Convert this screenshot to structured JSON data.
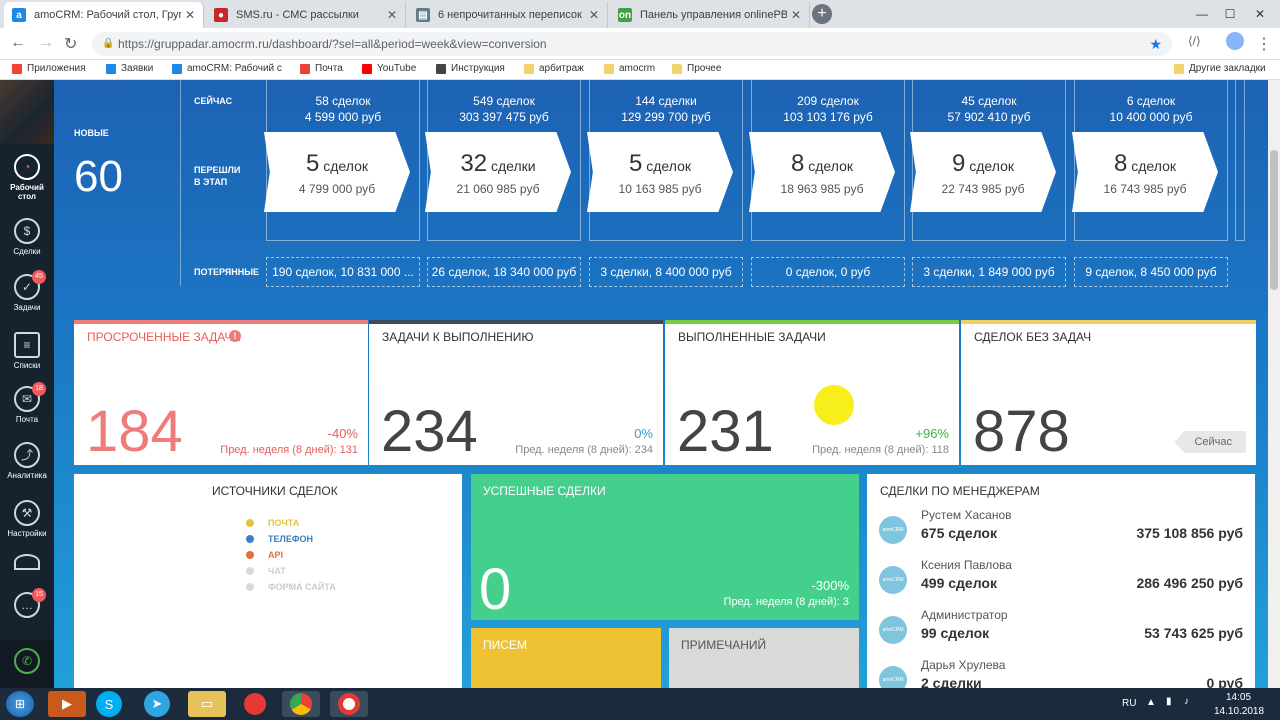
{
  "browser": {
    "tabs": [
      {
        "title": "amoCRM: Рабочий стол, Группа",
        "fav": "a",
        "color": "#1e88e5"
      },
      {
        "title": "SMS.ru - СМС рассылки",
        "fav": "🍒",
        "color": "#c62828"
      },
      {
        "title": "6 непрочитанных переписок",
        "fav": "▤",
        "color": "#607d8b"
      },
      {
        "title": "Панель управления onlinePBX",
        "fav": "on",
        "color": "#43a047"
      }
    ],
    "url": "https://gruppadar.amocrm.ru/dashboard/?sel=all&period=week&view=conversion",
    "bookmarks": [
      "Приложения",
      "Заявки",
      "amoCRM: Рабочий с",
      "Почта",
      "YouTube",
      "Инструкция",
      "арбитраж",
      "amocrm",
      "Прочее",
      "Другие закладки"
    ]
  },
  "sidebar": {
    "items": [
      {
        "label": "Рабочий стол",
        "icon": "dashboard-icon",
        "badge": ""
      },
      {
        "label": "Сделки",
        "icon": "dollar-icon",
        "badge": ""
      },
      {
        "label": "Задачи",
        "icon": "check-icon",
        "badge": "45"
      },
      {
        "label": "Списки",
        "icon": "list-icon",
        "badge": ""
      },
      {
        "label": "Почта",
        "icon": "mail-icon",
        "badge": "18"
      },
      {
        "label": "Аналитика",
        "icon": "chart-icon",
        "badge": ""
      },
      {
        "label": "Настройки",
        "icon": "wrench-icon",
        "badge": ""
      },
      {
        "label": "",
        "icon": "chat-icon",
        "badge": "15"
      }
    ]
  },
  "funnel": {
    "now_label": "СЕЙЧАС",
    "moved_label": "ПЕРЕШЛИ В ЭТАП",
    "lost_label": "ПОТЕРЯННЫЕ",
    "new_label": "НОВЫЕ",
    "new_count": "60",
    "stages": [
      {
        "now_deals": "58 сделок",
        "now_sum": "4 599 000 руб",
        "moved_num": "5",
        "moved_unit": "сделок",
        "moved_sum": "4 799 000 руб",
        "lost": "190 сделок, 10 831 000 ..."
      },
      {
        "now_deals": "549 сделок",
        "now_sum": "303 397 475 руб",
        "moved_num": "32",
        "moved_unit": "сделки",
        "moved_sum": "21 060 985 руб",
        "lost": "26 сделок, 18 340 000 руб"
      },
      {
        "now_deals": "144 сделки",
        "now_sum": "129 299 700 руб",
        "moved_num": "5",
        "moved_unit": "сделок",
        "moved_sum": "10 163 985 руб",
        "lost": "3 сделки, 8 400 000 руб"
      },
      {
        "now_deals": "209 сделок",
        "now_sum": "103 103 176 руб",
        "moved_num": "8",
        "moved_unit": "сделок",
        "moved_sum": "18 963 985 руб",
        "lost": "0 сделок, 0 руб"
      },
      {
        "now_deals": "45 сделок",
        "now_sum": "57 902 410 руб",
        "moved_num": "9",
        "moved_unit": "сделок",
        "moved_sum": "22 743 985 руб",
        "lost": "3 сделки, 1 849 000 руб"
      },
      {
        "now_deals": "6 сделок",
        "now_sum": "10 400 000 руб",
        "moved_num": "8",
        "moved_unit": "сделок",
        "moved_sum": "16 743 985 руб",
        "lost": "9 сделок, 8 450 000 руб"
      }
    ]
  },
  "cards": [
    {
      "title": "ПРОСРОЧЕННЫЕ ЗАДАЧИ",
      "value": "184",
      "pct": "-40%",
      "prev": "Пред. неделя (8 дней): 131",
      "bar": "#f07b7b",
      "valcolor": "#f07b7b",
      "pctcolor": "#e85c5c",
      "prevcolor": "#e85c5c"
    },
    {
      "title": "ЗАДАЧИ К ВЫПОЛНЕНИЮ",
      "value": "234",
      "pct": "0%",
      "prev": "Пред. неделя (8 дней): 234",
      "bar": "#3d4b5a",
      "valcolor": "#444",
      "pctcolor": "#29a3d8",
      "prevcolor": "#888"
    },
    {
      "title": "ВЫПОЛНЕННЫЕ ЗАДАЧИ",
      "value": "231",
      "pct": "+96%",
      "prev": "Пред. неделя (8 дней): 118",
      "bar": "#7ac943",
      "valcolor": "#444",
      "pctcolor": "#3fae49",
      "prevcolor": "#888"
    },
    {
      "title": "СДЕЛОК БЕЗ ЗАДАЧ",
      "value": "878",
      "pct": "",
      "prev": "",
      "bar": "#f0d060",
      "valcolor": "#444",
      "pctcolor": "#444",
      "prevcolor": "#888",
      "button": "Сейчас"
    }
  ],
  "sources": {
    "title": "ИСТОЧНИКИ СДЕЛОК",
    "legend": [
      {
        "label": "ПОЧТА",
        "color": "#e8c23a"
      },
      {
        "label": "ТЕЛЕФОН",
        "color": "#3d7fc4"
      },
      {
        "label": "API",
        "color": "#e07040"
      },
      {
        "label": "ЧАТ",
        "color": "#d8d8d8"
      },
      {
        "label": "ФОРМА САЙТА",
        "color": "#d8d8d8"
      }
    ]
  },
  "success": {
    "title": "УСПЕШНЫЕ СДЕЛКИ",
    "value": "0",
    "pct": "-300%",
    "prev": "Пред. неделя (8 дней): 3"
  },
  "letters": {
    "title": "ПИСЕМ"
  },
  "notes": {
    "title": "ПРИМЕЧАНИЙ"
  },
  "managers": {
    "title": "СДЕЛКИ ПО МЕНЕДЖЕРАМ",
    "rows": [
      {
        "name": "Рустем Хасанов",
        "count": "675 сделок",
        "sum": "375 108 856 руб"
      },
      {
        "name": "Ксения Павлова",
        "count": "499 сделок",
        "sum": "286 496 250 руб"
      },
      {
        "name": "Администратор",
        "count": "99 сделок",
        "sum": "53 743 625 руб"
      },
      {
        "name": "Дарья Хрулева",
        "count": "2 сделки",
        "sum": "0 руб"
      }
    ],
    "avatar_text": "amoCRM"
  },
  "taskbar": {
    "lang": "RU",
    "time": "14:05",
    "date": "14.10.2018"
  }
}
